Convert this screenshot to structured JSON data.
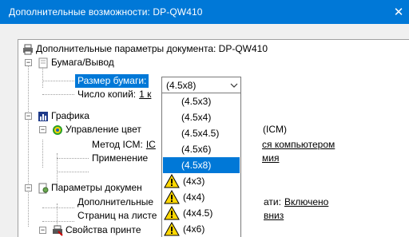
{
  "window": {
    "title": "Дополнительные возможности: DP-QW410",
    "close_glyph": "✕"
  },
  "tree": {
    "root_label": "Дополнительные параметры документа: DP-QW410",
    "paper_output": "Бумага/Вывод",
    "paper_size_label": "Размер бумаги:",
    "copies_label": "Число копий:",
    "copies_value": "1 к",
    "graphics": "Графика",
    "icm_label": "Управление цвет",
    "icm_suffix": "(ICM)",
    "icm_method_label": "Метод ICM:",
    "icm_method_value_a": "IC",
    "icm_method_value_b": "ся компьютером",
    "apply_label": "Применение",
    "apply_value": "мия",
    "doc_params": "Параметры докумен",
    "advanced_label": "Дополнительные",
    "advanced_value_prefix": "ати:",
    "advanced_value": "Включено",
    "pages_label": "Страниц на листе",
    "pages_value": "вниз",
    "printer_props": "Свойства принте"
  },
  "combo": {
    "value": "(4.5x8)"
  },
  "dropdown": {
    "options": [
      {
        "label": "(4.5x3)",
        "warning": false,
        "selected": false
      },
      {
        "label": "(4.5x4)",
        "warning": false,
        "selected": false
      },
      {
        "label": "(4.5x4.5)",
        "warning": false,
        "selected": false
      },
      {
        "label": "(4.5x6)",
        "warning": false,
        "selected": false
      },
      {
        "label": "(4.5x8)",
        "warning": false,
        "selected": true
      },
      {
        "label": "(4x3)",
        "warning": true,
        "selected": false
      },
      {
        "label": "(4x4)",
        "warning": true,
        "selected": false
      },
      {
        "label": "(4x4.5)",
        "warning": true,
        "selected": false
      },
      {
        "label": "(4x6)",
        "warning": true,
        "selected": false
      }
    ]
  },
  "colors": {
    "titlebar": "#0078d7",
    "selection": "#0078d7",
    "warning": "#ffd700"
  }
}
